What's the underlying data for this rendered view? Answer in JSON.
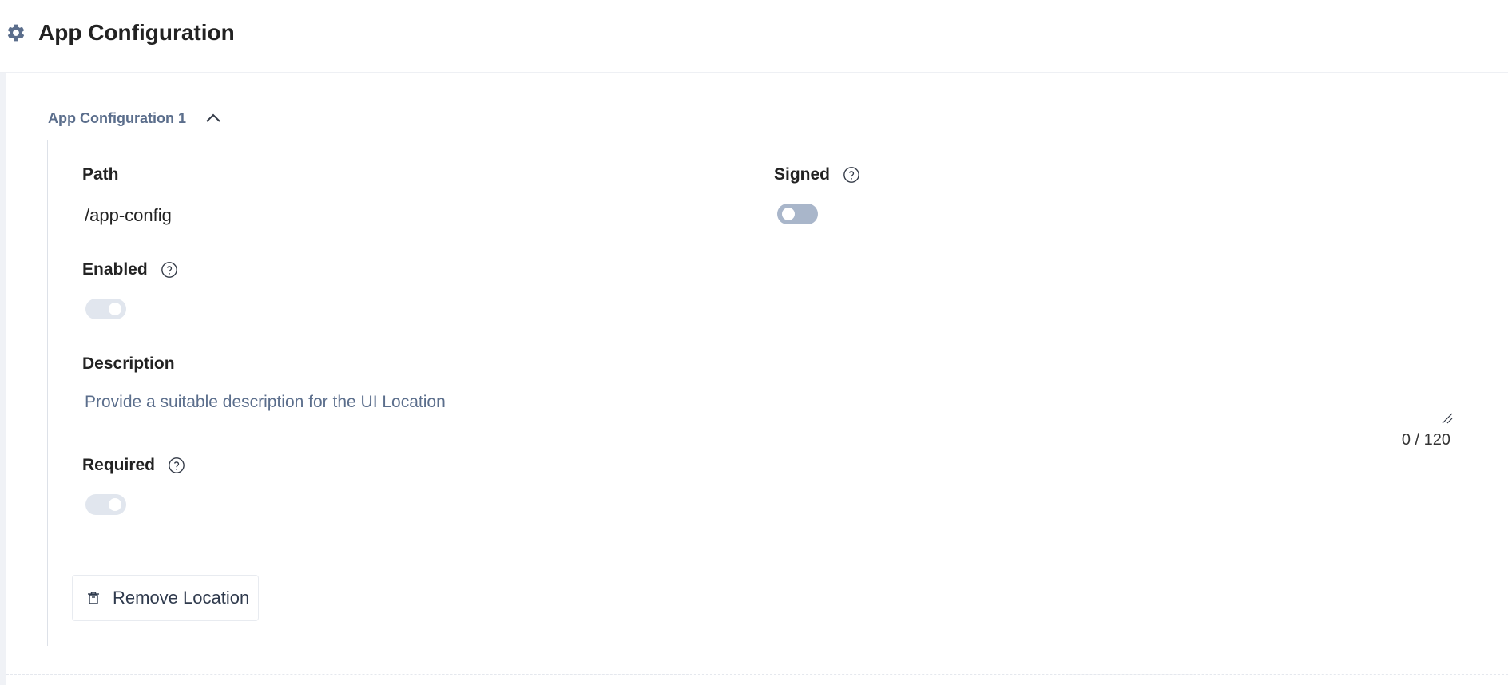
{
  "header": {
    "title": "App Configuration",
    "icon": "gear-icon"
  },
  "section": {
    "title": "App Configuration 1",
    "collapse_icon": "chevron-up-icon",
    "fields": {
      "path": {
        "label": "Path",
        "value": "/app-config"
      },
      "signed": {
        "label": "Signed",
        "state": "off"
      },
      "enabled": {
        "label": "Enabled",
        "state": "on-disabled"
      },
      "description": {
        "label": "Description",
        "placeholder": "Provide a suitable description for the UI Location",
        "counter": "0 / 120"
      },
      "required": {
        "label": "Required",
        "state": "on-disabled"
      }
    },
    "remove_button": {
      "label": "Remove Location",
      "icon": "trash-icon"
    }
  },
  "colors": {
    "accent_text": "#5b6e8c",
    "toggle_off": "#a9b6ca",
    "toggle_disabled": "#e1e6ee"
  }
}
